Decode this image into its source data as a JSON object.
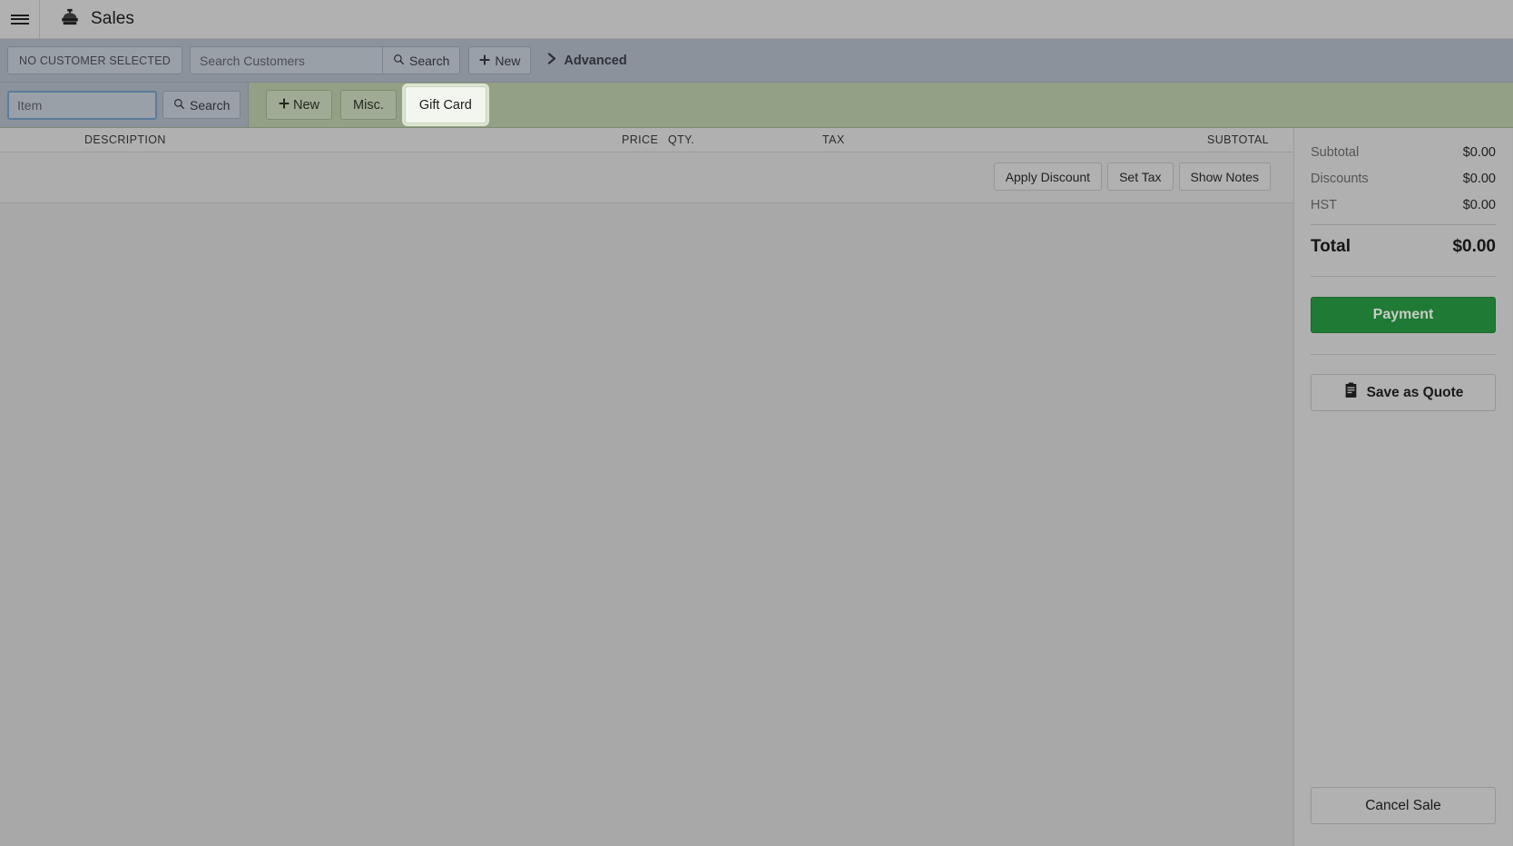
{
  "header": {
    "menu_icon": "hamburger-icon",
    "app_icon": "cash-register-icon",
    "title": "Sales"
  },
  "customer_bar": {
    "selected_customer_label": "NO CUSTOMER SELECTED",
    "search_placeholder": "Search Customers",
    "search_value": "",
    "search_button": "Search",
    "search_icon": "magnifier-icon",
    "new_button": "New",
    "new_icon": "plus-icon",
    "advanced_label": "Advanced",
    "advanced_icon": "chevron-right-icon"
  },
  "item_bar": {
    "item_placeholder": "Item",
    "item_value": "",
    "search_button": "Search",
    "search_icon": "magnifier-icon",
    "new_button": "New",
    "new_icon": "plus-icon",
    "misc_button": "Misc.",
    "gift_card_button": "Gift Card"
  },
  "cart": {
    "columns": {
      "description": "DESCRIPTION",
      "price": "PRICE",
      "qty": "QTY.",
      "tax": "TAX",
      "subtotal": "SUBTOTAL"
    },
    "rows": [],
    "actions": {
      "apply_discount": "Apply Discount",
      "set_tax": "Set Tax",
      "show_notes": "Show Notes"
    }
  },
  "totals": {
    "lines": [
      {
        "label": "Subtotal",
        "value": "$0.00"
      },
      {
        "label": "Discounts",
        "value": "$0.00"
      },
      {
        "label": "HST",
        "value": "$0.00"
      }
    ],
    "total_label": "Total",
    "total_value": "$0.00",
    "payment_button": "Payment",
    "save_quote_button": "Save as Quote",
    "save_quote_icon": "clipboard-receipt-icon",
    "cancel_button": "Cancel Sale"
  },
  "colors": {
    "payment_green": "#1f7a35",
    "customer_bar": "#8b929b",
    "item_bar": "#93a085",
    "page_bg": "#adadad",
    "focus_blue": "#5b7c9b"
  }
}
